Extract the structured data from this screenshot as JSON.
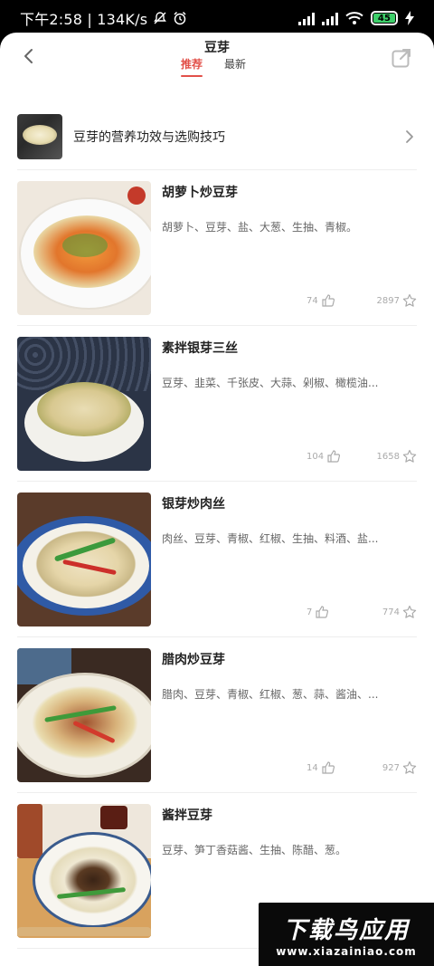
{
  "statusbar": {
    "time_text": "下午2:58 | 134K/s",
    "battery": "45"
  },
  "header": {
    "title": "豆芽",
    "tabs": [
      {
        "label": "推荐",
        "active": true
      },
      {
        "label": "最新",
        "active": false
      }
    ]
  },
  "banner": {
    "text": "豆芽的营养功效与选购技巧"
  },
  "recipes": [
    {
      "title": "胡萝卜炒豆芽",
      "ingredients": "胡萝卜、豆芽、盐、大葱、生抽、青椒。",
      "likes": "74",
      "favorites": "2897"
    },
    {
      "title": "素拌银芽三丝",
      "ingredients": "豆芽、韭菜、千张皮、大蒜、剁椒、橄榄油...",
      "likes": "104",
      "favorites": "1658"
    },
    {
      "title": "银芽炒肉丝",
      "ingredients": "肉丝、豆芽、青椒、红椒、生抽、料酒、盐...",
      "likes": "7",
      "favorites": "774"
    },
    {
      "title": "腊肉炒豆芽",
      "ingredients": "腊肉、豆芽、青椒、红椒、葱、蒜、酱油、...",
      "likes": "14",
      "favorites": "927"
    },
    {
      "title": "酱拌豆芽",
      "ingredients": "豆芽、笋丁香菇酱、生抽、陈醋、葱。",
      "likes": "",
      "favorites": ""
    }
  ],
  "watermark": {
    "title": "下载鸟应用",
    "url": "www.xiazainiao.com"
  },
  "icons": {
    "back": "chevron-left-icon",
    "share": "share-icon",
    "banner_arrow": "chevron-right-icon",
    "like": "thumbs-up-icon",
    "favorite": "star-icon"
  },
  "colors": {
    "accent": "#e25049",
    "text_primary": "#222222",
    "text_secondary": "#666666",
    "meta": "#aaaaaa"
  }
}
